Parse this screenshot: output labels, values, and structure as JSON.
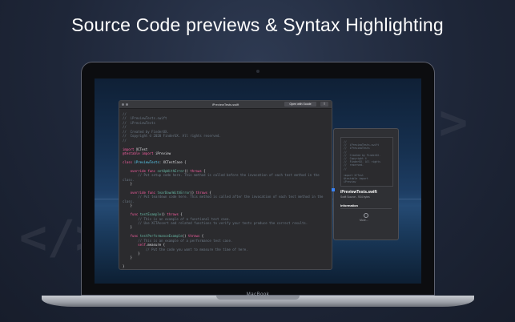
{
  "headline": "Source Code previews & Syntax Highlighting",
  "decorations": {
    "left_glyph": "</>",
    "right_glyph": ">"
  },
  "laptop": {
    "bezel_label": "MacBook"
  },
  "editor": {
    "title": "iPreviewTests.swift",
    "open_button": "Open with Xcode",
    "share_icon": "share-icon",
    "code_lines": [
      [
        {
          "t": "//",
          "k": "comment"
        }
      ],
      [
        {
          "t": "//  iPreviewTests.swift",
          "k": "comment"
        }
      ],
      [
        {
          "t": "//  iPreviewTests",
          "k": "comment"
        }
      ],
      [
        {
          "t": "//",
          "k": "comment"
        }
      ],
      [
        {
          "t": "//  Created by FinderUX.",
          "k": "comment"
        }
      ],
      [
        {
          "t": "//  Copyright © 2020 FinderUX. All rights reserved.",
          "k": "comment"
        }
      ],
      [
        {
          "t": "//",
          "k": "comment"
        }
      ],
      [
        {
          "t": "",
          "k": "plain"
        }
      ],
      [
        {
          "t": "import ",
          "k": "kw"
        },
        {
          "t": "XCTest",
          "k": "plain"
        }
      ],
      [
        {
          "t": "@testable ",
          "k": "kw"
        },
        {
          "t": "import ",
          "k": "kw"
        },
        {
          "t": "iPreview",
          "k": "plain"
        }
      ],
      [
        {
          "t": "",
          "k": "plain"
        }
      ],
      [
        {
          "t": "class ",
          "k": "kw"
        },
        {
          "t": "iPreviewTests",
          "k": "type"
        },
        {
          "t": ": XCTestCase {",
          "k": "plain"
        }
      ],
      [
        {
          "t": "",
          "k": "plain"
        }
      ],
      [
        {
          "t": "    override ",
          "k": "kw"
        },
        {
          "t": "func ",
          "k": "kw"
        },
        {
          "t": "setUpWithError",
          "k": "fn"
        },
        {
          "t": "() ",
          "k": "plain"
        },
        {
          "t": "throws",
          "k": "kw"
        },
        {
          "t": " {",
          "k": "plain"
        }
      ],
      [
        {
          "t": "        // Put setup code here. This method is called before the invocation of each test method in the",
          "k": "comment"
        }
      ],
      [
        {
          "t": "class.",
          "k": "comment"
        }
      ],
      [
        {
          "t": "    }",
          "k": "plain"
        }
      ],
      [
        {
          "t": "",
          "k": "plain"
        }
      ],
      [
        {
          "t": "    override ",
          "k": "kw"
        },
        {
          "t": "func ",
          "k": "kw"
        },
        {
          "t": "tearDownWithError",
          "k": "fn"
        },
        {
          "t": "() ",
          "k": "plain"
        },
        {
          "t": "throws",
          "k": "kw"
        },
        {
          "t": " {",
          "k": "plain"
        }
      ],
      [
        {
          "t": "        // Put teardown code here. This method is called after the invocation of each test method in the",
          "k": "comment"
        }
      ],
      [
        {
          "t": "class.",
          "k": "comment"
        }
      ],
      [
        {
          "t": "    }",
          "k": "plain"
        }
      ],
      [
        {
          "t": "",
          "k": "plain"
        }
      ],
      [
        {
          "t": "    func ",
          "k": "kw"
        },
        {
          "t": "testExample",
          "k": "fn"
        },
        {
          "t": "() ",
          "k": "plain"
        },
        {
          "t": "throws",
          "k": "kw"
        },
        {
          "t": " {",
          "k": "plain"
        }
      ],
      [
        {
          "t": "        // This is an example of a functional test case.",
          "k": "comment"
        }
      ],
      [
        {
          "t": "        // Use XCTAssert and related functions to verify your tests produce the correct results.",
          "k": "comment"
        }
      ],
      [
        {
          "t": "    }",
          "k": "plain"
        }
      ],
      [
        {
          "t": "",
          "k": "plain"
        }
      ],
      [
        {
          "t": "    func ",
          "k": "kw"
        },
        {
          "t": "testPerformanceExample",
          "k": "fn"
        },
        {
          "t": "() ",
          "k": "plain"
        },
        {
          "t": "throws",
          "k": "kw"
        },
        {
          "t": " {",
          "k": "plain"
        }
      ],
      [
        {
          "t": "        // This is an example of a performance test case.",
          "k": "comment"
        }
      ],
      [
        {
          "t": "        self",
          "k": "kw"
        },
        {
          "t": ".measure {",
          "k": "plain"
        }
      ],
      [
        {
          "t": "            // Put the code you want to measure the time of here.",
          "k": "comment"
        }
      ],
      [
        {
          "t": "        }",
          "k": "plain"
        }
      ],
      [
        {
          "t": "    }",
          "k": "plain"
        }
      ],
      [
        {
          "t": "",
          "k": "plain"
        }
      ],
      [
        {
          "t": "}",
          "k": "plain"
        }
      ]
    ]
  },
  "preview_panel": {
    "thumbnail_code": "//\n//  iPreviewTests.swift\n//  iPreviewTests\n//\n//  Created by FinderUX.\n//  Copyright ©\n//  FinderUX. All rights\n//  reserved.\n//\n\nimport XCTest\n@testable import\niPreview",
    "file_name": "iPreviewTests.swift",
    "file_meta": "Swift Source - 934 bytes",
    "section_title": "Information",
    "more_icon": "more-icon",
    "more_label": "More..."
  },
  "colors": {
    "keyword": "#fc5fa3",
    "type": "#5dd8ff",
    "comment": "#6c7986",
    "function": "#67b7a4",
    "plain": "#dfe0e3"
  }
}
